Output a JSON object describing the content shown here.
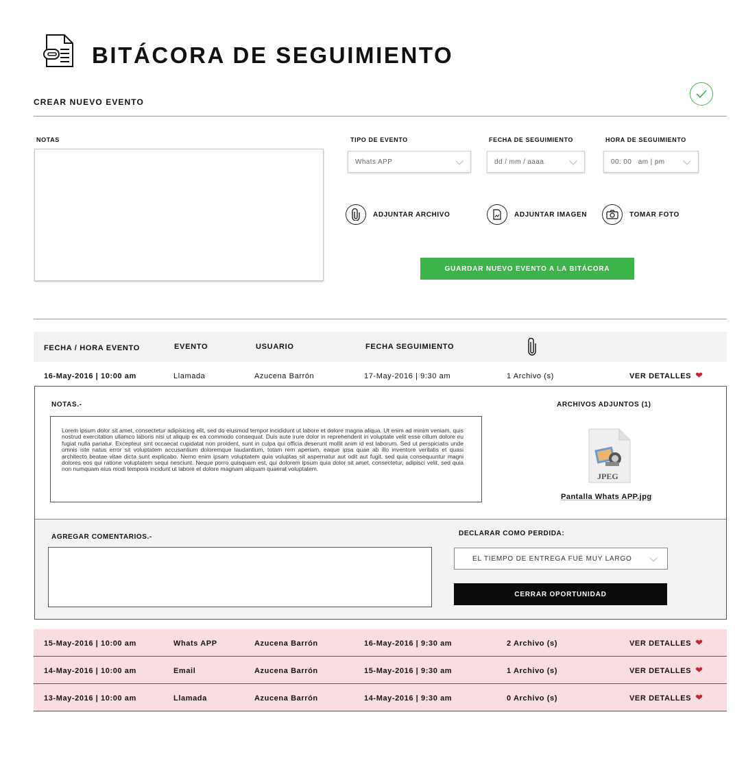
{
  "header": {
    "title": "BITÁCORA DE SEGUIMIENTO",
    "subtitle": "CREAR NUEVO EVENTO",
    "icon": "document-attachment-icon",
    "check_icon": "check-circle-icon"
  },
  "form": {
    "notes_label": "NOTAS",
    "event_type_label": "TIPO DE EVENTO",
    "event_type_value": "Whats APP",
    "followup_date_label": "FECHA DE SEGUIMIENTO",
    "followup_date_value": "dd / mm / aaaa",
    "followup_time_label": "HORA DE SEGUIMIENTO",
    "followup_time_value": "00: 00   am | pm",
    "attach_file": "ADJUNTAR ARCHIVO",
    "attach_image": "ADJUNTAR IMAGEN",
    "take_photo": "TOMAR FOTO",
    "save_button": "GUARDAR NUEVO EVENTO A LA BITÁCORA"
  },
  "table": {
    "headers": {
      "datetime": "FECHA / HORA EVENTO",
      "event": "EVENTO",
      "user": "USUARIO",
      "followup": "FECHA SEGUIMIENTO",
      "attachment_icon": "paperclip-icon"
    },
    "rows": [
      {
        "datetime": "16-May-2016 | 10:00 am",
        "event": "Llamada",
        "user": "Azucena Barrón",
        "followup": "17-May-2016 | 9:30 am",
        "files": "1 Archivo (s)",
        "action": "VER DETALLES"
      },
      {
        "datetime": "15-May-2016 | 10:00 am",
        "event": "Whats APP",
        "user": "Azucena Barrón",
        "followup": "16-May-2016 | 9:30 am",
        "files": "2 Archivo (s)",
        "action": "VER DETALLES"
      },
      {
        "datetime": "14-May-2016 | 10:00 am",
        "event": "Email",
        "user": "Azucena Barrón",
        "followup": "15-May-2016 | 9:30 am",
        "files": "1 Archivo (s)",
        "action": "VER DETALLES"
      },
      {
        "datetime": "13-May-2016 | 10:00 am",
        "event": "Llamada",
        "user": "Azucena Barrón",
        "followup": "14-May-2016 | 9:30 am",
        "files": "0 Archivo (s)",
        "action": "VER DETALLES"
      }
    ]
  },
  "detail": {
    "notes_label": "NOTAS.-",
    "notes_text": "Lorem ipsum dolor sit amet, consectetur adipisicing elit, sed do eiusmod tempor incididunt ut labore et dolore magna aliqua. Ut enim ad minim veniam, quis nostrud exercitation ullamco laboris nisi ut aliquip ex ea commodo consequat. Duis aute irure dolor in reprehenderit in voluptate velit esse cillum dolore eu fugiat nulla pariatur. Excepteur sint occaecat cupidatat non proident, sunt in culpa qui officia deserunt mollit anim id est laborum. Sed ut perspiciatis unde omnis iste natus error sit voluptatem accusantium doloremque laudantium, totam rem aperiam, eaque ipsa quae ab illo inventore veritatis et quasi architecto beatae vitae dicta sunt explicabo. Nemo enim ipsam voluptatem quia voluptas sit aspernatur aut odit aut fugit, sed quia consequuntur magni dolores eos qui ratione voluptatem sequi nesciunt. Neque porro quisquam est, qui dolorem ipsum quia dolor sit amet, consectetur, adipisci velit, sed quia non numquam eius modi tempora incidunt ut labore et dolore magnam aliquam quaerat voluptatem.",
    "attachments_label": "ARCHIVOS ADJUNTOS (1)",
    "file_type": "JPEG",
    "file_name": "Pantalla Whats APP.jpg",
    "comments_label": "AGREGAR COMENTARIOS.-",
    "lost_label": "DECLARAR COMO PERDIDA:",
    "lost_reason": "EL TIEMPO DE ENTREGA FUÉ MUY LARGO",
    "close_button": "CERRAR OPORTUNIDAD"
  },
  "colors": {
    "green": "#3db44a",
    "pink_row": "#f9dde1",
    "red_icon": "#cc1f2f"
  }
}
